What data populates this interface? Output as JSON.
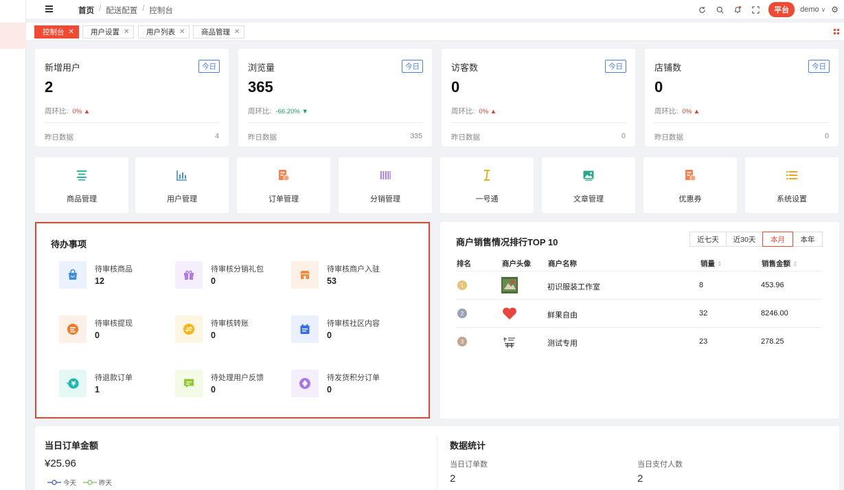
{
  "header": {
    "breadcrumbs": [
      "首页",
      "配送配置",
      "控制台"
    ],
    "platform_label": "平台",
    "user_name": "demo"
  },
  "tabs": [
    {
      "label": "控制台",
      "active": true
    },
    {
      "label": "用户设置",
      "active": false
    },
    {
      "label": "用户列表",
      "active": false
    },
    {
      "label": "商品管理",
      "active": false
    }
  ],
  "stats": [
    {
      "title": "新增用户",
      "badge": "今日",
      "value": "2",
      "ratio_label": "周环比:",
      "ratio": "0%",
      "trend": "up",
      "yesterday_label": "昨日数据",
      "yesterday": "4"
    },
    {
      "title": "浏览量",
      "badge": "今日",
      "value": "365",
      "ratio_label": "周环比:",
      "ratio": "-66.20%",
      "trend": "down",
      "yesterday_label": "昨日数据",
      "yesterday": "335"
    },
    {
      "title": "访客数",
      "badge": "今日",
      "value": "0",
      "ratio_label": "周环比:",
      "ratio": "0%",
      "trend": "up",
      "yesterday_label": "昨日数据",
      "yesterday": "0"
    },
    {
      "title": "店铺数",
      "badge": "今日",
      "value": "0",
      "ratio_label": "周环比:",
      "ratio": "0%",
      "trend": "up",
      "yesterday_label": "昨日数据",
      "yesterday": "0"
    }
  ],
  "quick_nav": [
    {
      "label": "商品管理",
      "icon": "list-lines-icon",
      "color": "#2ab7a3"
    },
    {
      "label": "用户管理",
      "icon": "bar-chart-icon",
      "color": "#3f8ee8"
    },
    {
      "label": "订单管理",
      "icon": "order-doc-icon",
      "color": "#f08552"
    },
    {
      "label": "分销管理",
      "icon": "barcode-icon",
      "color": "#a276e8"
    },
    {
      "label": "一号通",
      "icon": "cursor-i-icon",
      "color": "#e8b21a"
    },
    {
      "label": "文章管理",
      "icon": "picture-icon",
      "color": "#2aa88e"
    },
    {
      "label": "优惠券",
      "icon": "coupon-doc-icon",
      "color": "#f08552"
    },
    {
      "label": "系统设置",
      "icon": "menu-list-icon",
      "color": "#f2a51a"
    }
  ],
  "todo": {
    "title": "待办事项",
    "items": [
      {
        "label": "待审核商品",
        "value": "12",
        "icon": "shopping-bag-icon",
        "color": "#3a8ee6",
        "bg": "#eaf3fd"
      },
      {
        "label": "待审核分销礼包",
        "value": "0",
        "icon": "gift-icon",
        "color": "#b07ce8",
        "bg": "#f4eefd"
      },
      {
        "label": "待审核商户入驻",
        "value": "53",
        "icon": "store-icon",
        "color": "#f08a3c",
        "bg": "#fdf0e6"
      },
      {
        "label": "待审核提现",
        "value": "0",
        "icon": "withdraw-icon",
        "color": "#f07a2a",
        "bg": "#fdf0e6"
      },
      {
        "label": "待审核转账",
        "value": "0",
        "icon": "transfer-icon",
        "color": "#f5b616",
        "bg": "#fdf6e3"
      },
      {
        "label": "待审核社区内容",
        "value": "0",
        "icon": "calendar-icon",
        "color": "#3a6ee6",
        "bg": "#eaf0fd"
      },
      {
        "label": "待退款订单",
        "value": "1",
        "icon": "refund-icon",
        "color": "#1ab8b0",
        "bg": "#e4f8f6"
      },
      {
        "label": "待处理用户反馈",
        "value": "0",
        "icon": "chat-icon",
        "color": "#8fcb2a",
        "bg": "#f3fae6"
      },
      {
        "label": "待发货积分订单",
        "value": "0",
        "icon": "points-icon",
        "color": "#a878e8",
        "bg": "#f4eefd"
      }
    ]
  },
  "ranking": {
    "title": "商户销售情况排行TOP 10",
    "ranges": [
      "近七天",
      "近30天",
      "本月",
      "本年"
    ],
    "active_range": "本月",
    "columns": [
      "排名",
      "商户头像",
      "商户名称",
      "销量",
      "销售金额"
    ],
    "rows": [
      {
        "rank": "1",
        "name": "初识服装工作室",
        "sales": "8",
        "amount": "453.96",
        "avatar": "photo-avatar-icon",
        "color": "#e8c277"
      },
      {
        "rank": "2",
        "name": "鲜果自由",
        "sales": "32",
        "amount": "8246.00",
        "avatar": "heart-icon",
        "color": "#9aa3b5"
      },
      {
        "rank": "3",
        "name": "测试专用",
        "sales": "23",
        "amount": "278.25",
        "avatar": "text-logo-icon",
        "color": "#c6a38c"
      }
    ]
  },
  "bottom": {
    "order_title": "当日订单金额",
    "order_amount": "¥25.96",
    "legend_today": "今天",
    "legend_yesterday": "昨天",
    "stats_title": "数据统计",
    "stat1_label": "当日订单数",
    "stat1_value": "2",
    "stat2_label": "当日支付人数",
    "stat2_value": "2"
  },
  "colors": {
    "accent": "#f04a33",
    "badge_blue": "#4a7fe0",
    "up": "#e0402e",
    "down": "#19a05a"
  }
}
